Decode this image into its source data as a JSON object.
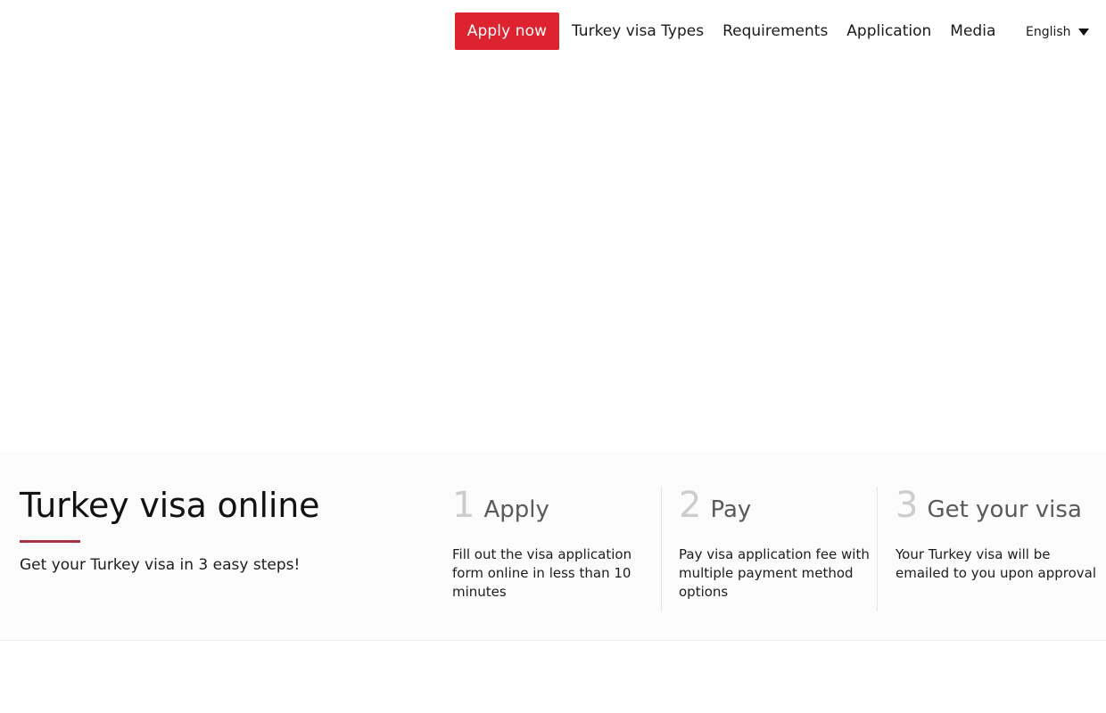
{
  "header": {
    "apply_button_label": "Apply now",
    "apply_button_color": "#dd2230",
    "nav_items": [
      {
        "label": "Turkey visa Types"
      },
      {
        "label": "Requirements"
      },
      {
        "label": "Application"
      },
      {
        "label": "Media"
      }
    ],
    "language": {
      "selected": "English",
      "caret_icon": "chevron-down-icon"
    }
  },
  "hero": {
    "background": "#ffffff"
  },
  "intro": {
    "title": "Turkey visa online",
    "rule_color": "#a93244",
    "subtitle": "Get your Turkey visa in 3 easy steps!"
  },
  "steps": [
    {
      "number": "1",
      "title": "Apply",
      "description": "Fill out the visa application form online in less than 10 minutes"
    },
    {
      "number": "2",
      "title": "Pay",
      "description": "Pay visa application fee with multiple payment method options"
    },
    {
      "number": "3",
      "title": "Get your visa",
      "description": "Your Turkey visa will be emailed to you upon approval"
    }
  ]
}
